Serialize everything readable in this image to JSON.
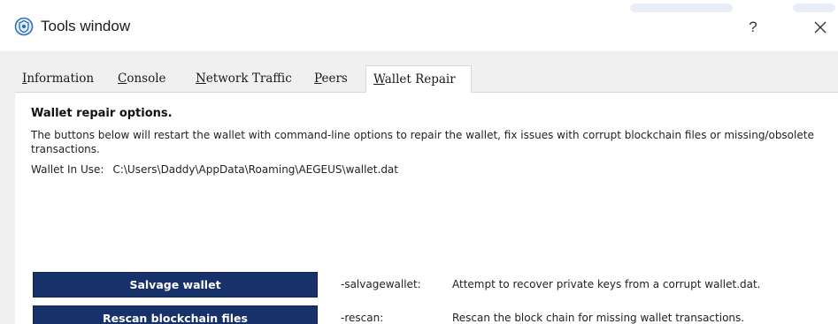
{
  "window": {
    "title": "Tools window",
    "help_label": "?",
    "icon": "shield-logo-icon",
    "close_icon": "close-icon"
  },
  "tabs": [
    {
      "label": "Information",
      "mnemonic": "I",
      "rest": "nformation",
      "active": false
    },
    {
      "label": "Console",
      "mnemonic": "C",
      "rest": "onsole",
      "active": false
    },
    {
      "label": "Network Traffic",
      "mnemonic": "N",
      "rest": "etwork Traffic",
      "active": false
    },
    {
      "label": "Peers",
      "mnemonic": "P",
      "rest": "eers",
      "active": false
    },
    {
      "label": "Wallet Repair",
      "mnemonic": "W",
      "rest": "allet Repair",
      "active": true
    }
  ],
  "repair": {
    "heading": "Wallet repair options.",
    "description": "The buttons below will restart the wallet with command-line options to repair the wallet, fix issues with corrupt blockchain files or missing/obsolete transactions.",
    "wallet_label": "Wallet In Use:",
    "wallet_path": "C:\\Users\\Daddy\\AppData\\Roaming\\AEGEUS\\wallet.dat",
    "actions": [
      {
        "button": "Salvage wallet",
        "arg": "-salvagewallet:",
        "desc": "Attempt to recover private keys from a corrupt wallet.dat."
      },
      {
        "button": "Rescan blockchain files",
        "arg": "-rescan:",
        "desc": "Rescan the block chain for missing wallet transactions."
      }
    ]
  },
  "colors": {
    "button_bg": "#17326b",
    "client_bg": "#f0f0f0",
    "panel_bg": "#ffffff"
  }
}
